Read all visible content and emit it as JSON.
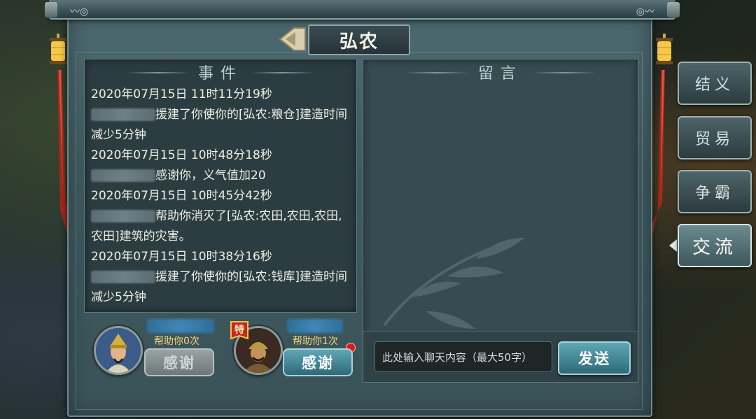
{
  "title": "弘农",
  "events": {
    "header": "事件",
    "entries": [
      {
        "time": "2020年07月15日 11时11分19秒",
        "text": "援建了你使你的[弘农:粮仓]建造时间减少5分钟"
      },
      {
        "time": "2020年07月15日 10时48分18秒",
        "text": "感谢你，义气值加20"
      },
      {
        "time": "2020年07月15日 10时45分42秒",
        "text": "帮助你消灭了[弘农:农田,农田,农田,农田]建筑的灾害。"
      },
      {
        "time": "2020年07月15日 10时38分16秒",
        "text": "援建了你使你的[弘农:钱库]建造时间减少5分钟"
      }
    ]
  },
  "messages": {
    "header": "留言",
    "input_placeholder": "此处输入聊天内容（最大50字）",
    "send_label": "发送"
  },
  "helpers": [
    {
      "help_text": "帮助你0次",
      "thanks_label": "感谢",
      "enabled": false
    },
    {
      "help_text": "帮助你1次",
      "thanks_label": "感谢",
      "enabled": true,
      "badge": "特"
    }
  ],
  "side_tabs": [
    {
      "label": "结义",
      "active": false
    },
    {
      "label": "贸易",
      "active": false
    },
    {
      "label": "争霸",
      "active": false
    },
    {
      "label": "交流",
      "active": true
    }
  ],
  "colors": {
    "accent": "#2e6a78",
    "help_text": "#f4d27a",
    "notification": "#d51e1e",
    "lantern": "#f5c84a",
    "ribbon": "#b3261e"
  }
}
